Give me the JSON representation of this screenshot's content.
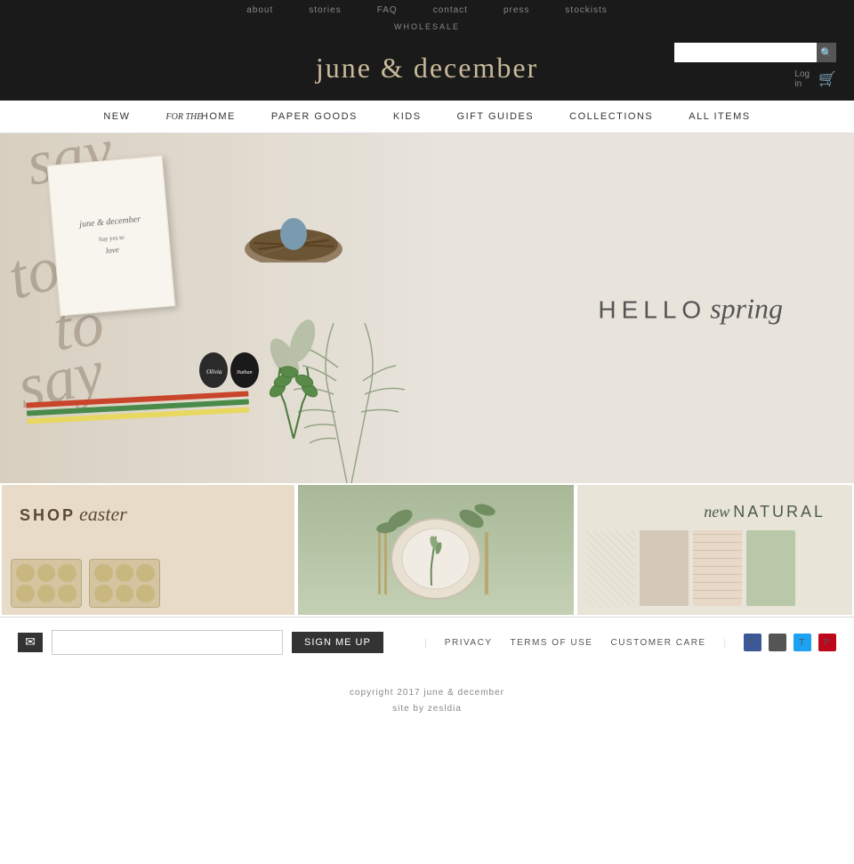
{
  "topBar": {
    "links": [
      "about",
      "stories",
      "FAQ",
      "contact",
      "press",
      "stockists"
    ]
  },
  "wholesale": {
    "label": "wholesale"
  },
  "header": {
    "siteTitle": "june & december",
    "searchPlaceholder": "",
    "loginLabel": "Log",
    "loginLabel2": "in",
    "cartLabel": "🛒"
  },
  "mainNav": {
    "items": [
      {
        "label": "NEW",
        "italic": false
      },
      {
        "label": "for the HOME",
        "italic": true
      },
      {
        "label": "PAPER GOODS",
        "italic": false
      },
      {
        "label": "KIDS",
        "italic": false
      },
      {
        "label": "GIFT GUIDES",
        "italic": false
      },
      {
        "label": "COLLECTIONS",
        "italic": false
      },
      {
        "label": "ALL ITEMS",
        "italic": false
      }
    ]
  },
  "hero": {
    "helloText": "HELLO",
    "springText": "spring"
  },
  "grid": {
    "item1": {
      "shopText": "SHOP",
      "easterText": "easter"
    },
    "item3": {
      "newText": "new",
      "naturalText": "NATURAL"
    }
  },
  "footer": {
    "newsletter": {
      "emailPlaceholder": "",
      "signUpLabel": "SIGN ME UP"
    },
    "links": [
      {
        "label": "PRIVACY"
      },
      {
        "label": "TERMS OF USE"
      },
      {
        "label": "CUSTOMER CARE"
      }
    ],
    "social": {
      "facebook": "f",
      "instagram": "◎",
      "twitter": "t",
      "pinterest": "p"
    },
    "copyright": "copyright 2017 june & december",
    "siteBy": "site by zesldia"
  },
  "paperGoods": {
    "label": "Paper Goods"
  }
}
